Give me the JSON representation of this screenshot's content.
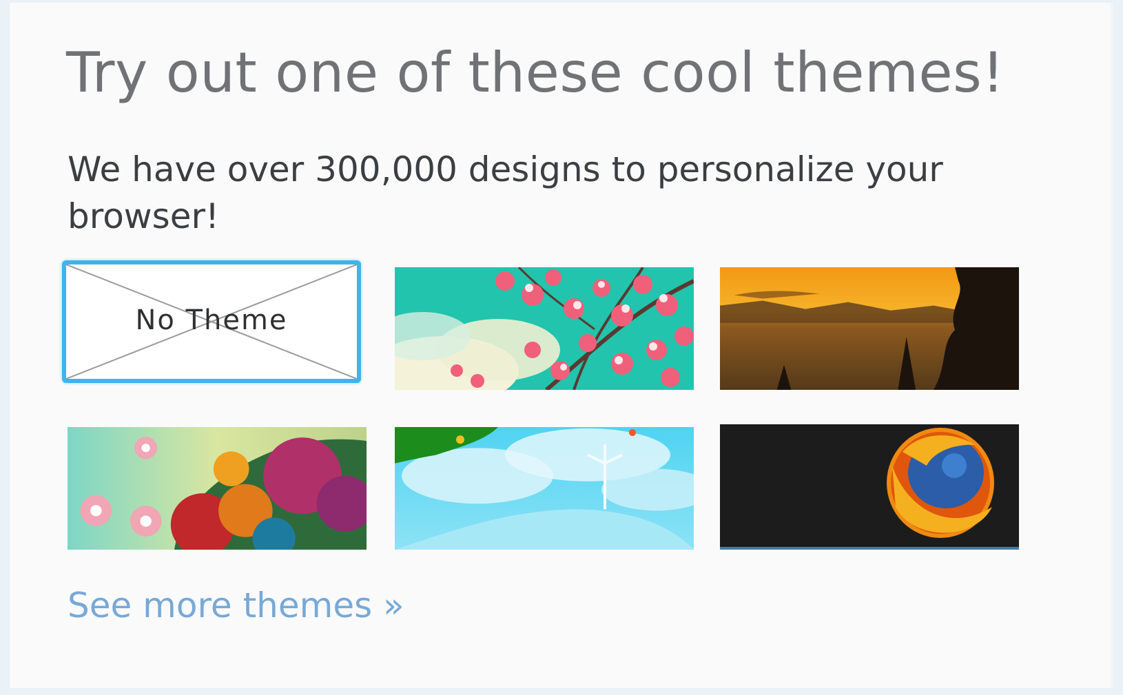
{
  "panel": {
    "title": "Try out one of these cool themes!",
    "subtitle": "We have over 300,000 designs to personalize your browser!"
  },
  "themes": [
    {
      "label": "No Theme",
      "selected": true,
      "icon": "no-theme-placeholder"
    },
    {
      "label": "",
      "selected": false,
      "icon": "cherry-blossom-theme"
    },
    {
      "label": "",
      "selected": false,
      "icon": "sunset-lake-theme"
    },
    {
      "label": "",
      "selected": false,
      "icon": "floral-art-theme"
    },
    {
      "label": "",
      "selected": false,
      "icon": "sky-windmill-theme"
    },
    {
      "label": "",
      "selected": false,
      "icon": "firefox-logo-theme"
    }
  ],
  "footer": {
    "more_link": "See more themes »"
  },
  "colors": {
    "selected_border": "#3db4ec",
    "link": "#77a9d6",
    "title": "#707275"
  }
}
